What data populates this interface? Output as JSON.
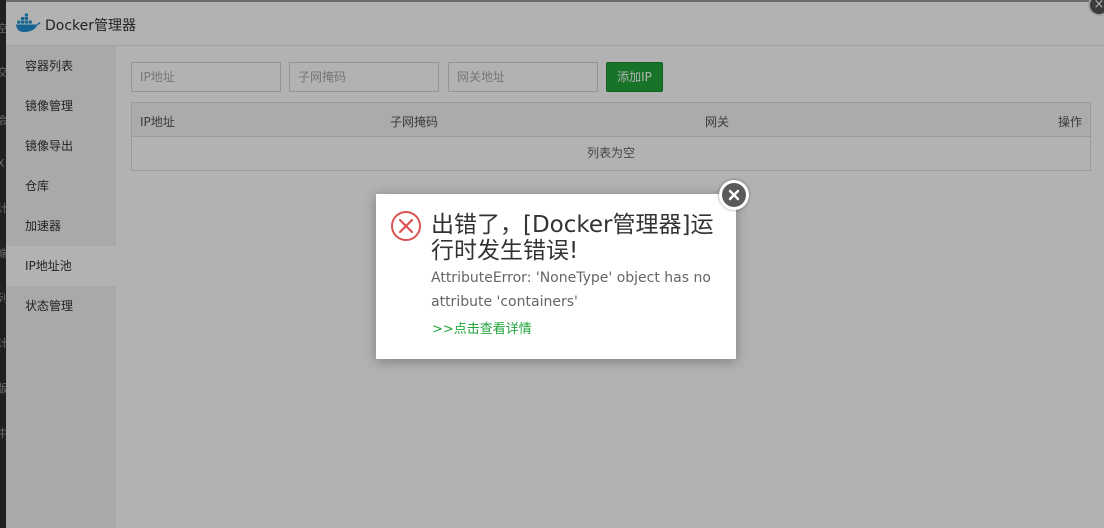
{
  "window": {
    "title": "Docker管理器"
  },
  "sidebar": {
    "items": [
      {
        "label": "容器列表"
      },
      {
        "label": "镜像管理"
      },
      {
        "label": "镜像导出"
      },
      {
        "label": "仓库"
      },
      {
        "label": "加速器"
      },
      {
        "label": "IP地址池",
        "active": true
      },
      {
        "label": "状态管理"
      }
    ]
  },
  "toolbar": {
    "ip_placeholder": "IP地址",
    "mask_placeholder": "子网掩码",
    "gateway_placeholder": "网关地址",
    "add_label": "添加IP"
  },
  "table": {
    "headers": [
      "IP地址",
      "子网掩码",
      "网关",
      "操作"
    ],
    "empty_text": "列表为空"
  },
  "dialog": {
    "title": "出错了，[Docker管理器]运行时发生错误!",
    "message": "AttributeError: 'NoneType' object has no attribute 'containers'",
    "link": ">>点击查看详情"
  },
  "colors": {
    "accent": "#20a53a",
    "error": "#d9534f"
  },
  "icons": {
    "logo": "docker-whale-icon",
    "error": "error-circle-x-icon",
    "close": "close-icon"
  }
}
